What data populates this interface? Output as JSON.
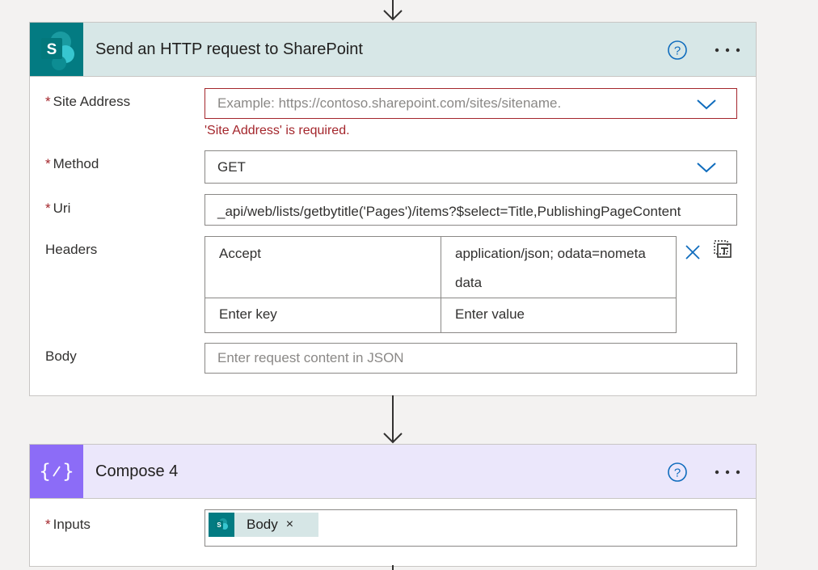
{
  "sharepoint_card": {
    "title": "Send an HTTP request to SharePoint",
    "icon": "sharepoint-icon",
    "header_bg": "#d7e7e7",
    "fields": {
      "site_address": {
        "label": "Site Address",
        "required_mark": "*",
        "placeholder": "Example: https://contoso.sharepoint.com/sites/sitename.",
        "error": "'Site Address' is required."
      },
      "method": {
        "label": "Method",
        "required_mark": "*",
        "value": "GET"
      },
      "uri": {
        "label": "Uri",
        "required_mark": "*",
        "value": "_api/web/lists/getbytitle('Pages')/items?$select=Title,PublishingPageContent"
      },
      "headers": {
        "label": "Headers",
        "rows": [
          {
            "key": "Accept",
            "value_line1": "application/json; odata=nometa",
            "value_line2": "data"
          }
        ],
        "key_placeholder": "Enter key",
        "value_placeholder": "Enter value"
      },
      "body": {
        "label": "Body",
        "placeholder": "Enter request content in JSON"
      }
    }
  },
  "compose_card": {
    "title": "Compose 4",
    "icon": "compose-icon",
    "header_bg": "#ebe7fb",
    "fields": {
      "inputs": {
        "label": "Inputs",
        "required_mark": "*",
        "token_label": "Body",
        "token_remove": "×"
      }
    }
  },
  "colors": {
    "sharepoint": "#037b82",
    "compose": "#8c6cf7",
    "error": "#a4262c",
    "accent": "#0f6cbd"
  }
}
